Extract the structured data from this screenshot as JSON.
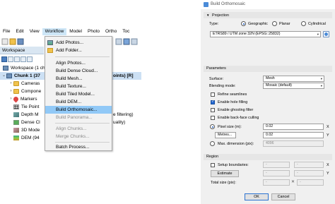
{
  "app": {
    "menu": [
      "File",
      "Edit",
      "View",
      "Workflow",
      "Model",
      "Photo",
      "Ortho",
      "Toc"
    ],
    "workspace_pane_title": "Workspace",
    "tree": {
      "workspace": "Workspace (1 ch",
      "chunk": "Chunk 1 (37",
      "chunk_suffix": "oints) [R]",
      "cameras": "Cameras",
      "components": "Compone",
      "markers": "Markers",
      "tie_points": "Tie Point",
      "depth_maps": "Depth M",
      "depth_suffix": "e filtering)",
      "dense_cloud": "Dense Cl",
      "dense_suffix": "uality)",
      "model": "3D Mode",
      "dem": "DEM (94"
    },
    "workflow_menu": {
      "add_photos": "Add Photos...",
      "add_folder": "Add Folder...",
      "align_photos": "Align Photos...",
      "build_dense_cloud": "Build Dense Cloud...",
      "build_mesh": "Build Mesh...",
      "build_texture": "Build Texture...",
      "build_tiled_model": "Build Tiled Model...",
      "build_dem": "Build DEM...",
      "build_orthomosaic": "Build Orthomosaic...",
      "build_panorama": "Build Panorama...",
      "align_chunks": "Align Chunks...",
      "merge_chunks": "Merge Chunks...",
      "batch_process": "Batch Process..."
    }
  },
  "dialog": {
    "title": "Build Orthomosaic",
    "projection": {
      "section": "Projection",
      "type_label": "Type:",
      "options": [
        "Geographic",
        "Planar",
        "Cylindrical"
      ],
      "selected": "Geographic",
      "crs": "ETRS89 / UTM zone 32N (EPSG::25832)"
    },
    "parameters": {
      "section": "Parameters",
      "surface_label": "Surface:",
      "surface_value": "Mesh",
      "blending_label": "Blending mode:",
      "blending_value": "Mosaic (default)",
      "refine_seamlines": "Refine seamlines",
      "enable_hole_filling": "Enable hole filling",
      "enable_ghosting_filter": "Enable ghosting filter",
      "enable_backface_culling": "Enable back-face culling",
      "pixel_size_label": "Pixel size (m):",
      "pixel_x": "0.02",
      "pixel_y": "0.02",
      "metres_label": "Metres...",
      "metres_x": "",
      "max_dimension_label": "Max. dimension (pix):",
      "max_dimension_value": "4096",
      "axis_x": "X",
      "axis_y": "Y"
    },
    "region": {
      "section": "Region",
      "setup_boundaries": "Setup boundaries:",
      "estimate": "Estimate",
      "total_size": "Total size (pix):",
      "dash": "-"
    },
    "buttons": {
      "ok": "OK",
      "cancel": "Cancel"
    },
    "close_glyph": "✕",
    "section_triangle": "▼"
  }
}
